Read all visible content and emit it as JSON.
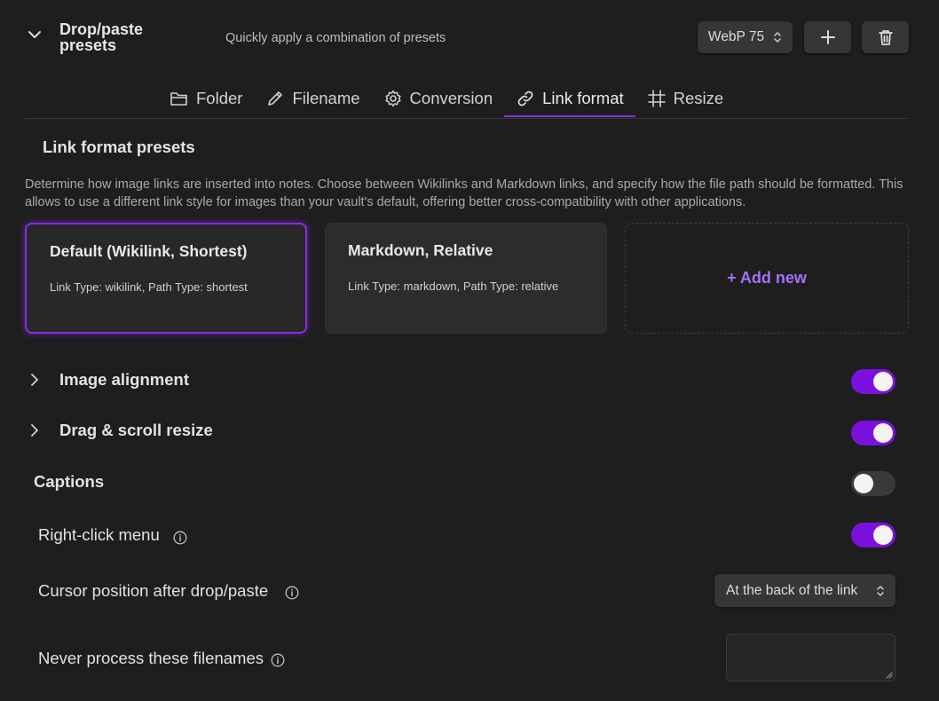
{
  "header": {
    "title": "Drop/paste presets",
    "description": "Quickly apply a combination of presets",
    "preset_value": "WebP 75"
  },
  "tabs": [
    {
      "label": "Folder",
      "icon": "folder-icon"
    },
    {
      "label": "Filename",
      "icon": "pencil-icon"
    },
    {
      "label": "Conversion",
      "icon": "gear-icon"
    },
    {
      "label": "Link format",
      "icon": "link-icon",
      "active": true
    },
    {
      "label": "Resize",
      "icon": "crop-icon"
    }
  ],
  "section": {
    "title": "Link format presets",
    "description": "Determine how image links are inserted into notes. Choose between Wikilinks and Markdown links, and specify how the file path should be formatted. This allows to use a different link style for images than your vault's default, offering better cross-compatibility with other applications."
  },
  "cards": [
    {
      "title": "Default (Wikilink, Shortest)",
      "subtitle": "Link Type: wikilink, Path Type: shortest",
      "selected": true
    },
    {
      "title": "Markdown, Relative",
      "subtitle": "Link Type: markdown, Path Type: relative",
      "selected": false
    }
  ],
  "add_new_label": "+ Add new",
  "settings": {
    "image_alignment": {
      "label": "Image alignment",
      "enabled": true
    },
    "drag_resize": {
      "label": "Drag & scroll resize",
      "enabled": true
    },
    "captions": {
      "label": "Captions",
      "enabled": false
    },
    "right_click": {
      "label": "Right-click menu",
      "enabled": true
    },
    "cursor_position": {
      "label": "Cursor position after drop/paste",
      "value": "At the back of the link"
    },
    "never_process": {
      "label": "Never process these filenames",
      "value": ""
    }
  },
  "colors": {
    "accent": "#8a2be2",
    "toggle_on": "#7c10de",
    "add_new": "#a371f7"
  }
}
